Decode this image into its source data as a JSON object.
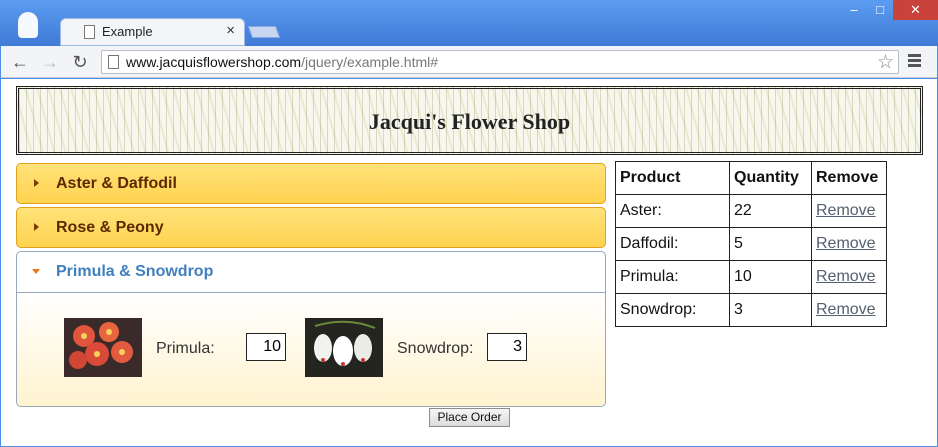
{
  "browser": {
    "tab_title": "Example",
    "tab_close": "×",
    "url_host": "www.jacquisflowershop.com",
    "url_path": "/jquery/example.html#",
    "icons": [
      "user-icon",
      "page-icon",
      "close-icon",
      "back-icon",
      "forward-icon",
      "reload-icon",
      "star-icon",
      "menu-icon"
    ]
  },
  "page": {
    "title": "Jacqui's Flower Shop",
    "accordion": [
      {
        "label": "Aster & Daffodil",
        "active": false
      },
      {
        "label": "Rose & Peony",
        "active": false
      },
      {
        "label": "Primula & Snowdrop",
        "active": true
      }
    ],
    "panel": {
      "items": [
        {
          "label": "Primula:",
          "value": "10"
        },
        {
          "label": "Snowdrop:",
          "value": "3"
        }
      ]
    },
    "place_order": "Place Order"
  },
  "summary_table": {
    "headers": [
      "Product",
      "Quantity",
      "Remove"
    ],
    "rows": [
      {
        "product": "Aster:",
        "quantity": "22",
        "remove": "Remove"
      },
      {
        "product": "Daffodil:",
        "quantity": "5",
        "remove": "Remove"
      },
      {
        "product": "Primula:",
        "quantity": "10",
        "remove": "Remove"
      },
      {
        "product": "Snowdrop:",
        "quantity": "3",
        "remove": "Remove"
      }
    ]
  },
  "colors": {
    "accordion_header": "#ffd34f",
    "active_label": "#3f7fbf",
    "titlebar": "#4f8ee6"
  }
}
